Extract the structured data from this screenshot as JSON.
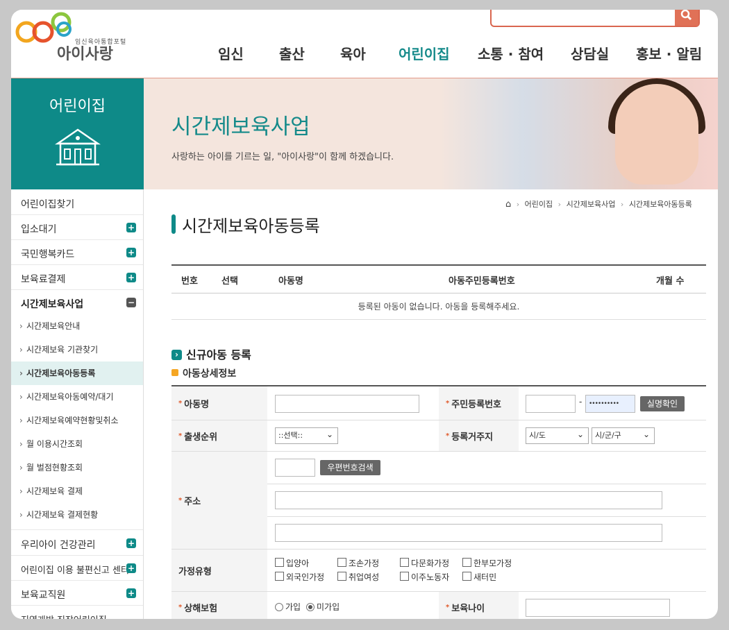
{
  "header": {
    "logo_tagline": "임신육아통합포털",
    "logo_name": "아이사랑",
    "search_placeholder": "",
    "nav": [
      {
        "label": "임신"
      },
      {
        "label": "출산"
      },
      {
        "label": "육아"
      },
      {
        "label": "어린이집"
      },
      {
        "label": "소통 · 참여"
      },
      {
        "label": "상담실"
      },
      {
        "label": "홍보 · 알림"
      }
    ]
  },
  "banner": {
    "section": "어린이집",
    "title": "시간제보육사업",
    "subtitle": "사랑하는 아이를 기르는 일, \"아이사랑\"이 함께 하겠습니다."
  },
  "sidebar": {
    "items": [
      {
        "label": "어린이집찾기"
      },
      {
        "label": "입소대기"
      },
      {
        "label": "국민행복카드"
      },
      {
        "label": "보육료결제"
      },
      {
        "label": "시간제보육사업"
      }
    ],
    "sub_items": [
      {
        "label": "시간제보육안내"
      },
      {
        "label": "시간제보육 기관찾기"
      },
      {
        "label": "시간제보육아동등록"
      },
      {
        "label": "시간제보육아동예약/대기"
      },
      {
        "label": "시간제보육예약현황및취소"
      },
      {
        "label": "월 이용시간조회"
      },
      {
        "label": "월 벌점현황조회"
      },
      {
        "label": "시간제보육 결제"
      },
      {
        "label": "시간제보육 결제현황"
      }
    ],
    "items2": [
      {
        "label": "우리아이 건강관리"
      },
      {
        "label": "어린이집 이용 불편신고 센터"
      },
      {
        "label": "보육교직원"
      },
      {
        "label": "지역개방 직장어린이집"
      }
    ],
    "plus": "+",
    "minus": "−"
  },
  "breadcrumb": {
    "home": "⌂",
    "items": [
      "어린이집",
      "시간제보육사업",
      "시간제보육아동등록"
    ],
    "sep": "›"
  },
  "page_title": "시간제보육아동등록",
  "children_table": {
    "headers": [
      "번호",
      "선택",
      "아동명",
      "아동주민등록번호",
      "개월 수"
    ],
    "empty_message": "등록된 아동이 없습니다. 아동을 등록해주세요."
  },
  "new_child": {
    "title": "신규아동 등록",
    "detail_title": "아동상세정보"
  },
  "form": {
    "name_label": "아동명",
    "name_value": "",
    "rrn_label": "주민등록번호",
    "rrn_first": "",
    "rrn_dash": "-",
    "rrn_second": "••••••••••",
    "verify_btn": "실명확인",
    "birth_order_label": "출생순위",
    "birth_order_value": "::선택::",
    "residence_label": "등록거주지",
    "sido_value": "시/도",
    "sigungu_value": "시/군/구",
    "address_label": "주소",
    "postcode_value": "",
    "postcode_btn": "우편번호검색",
    "address1": "",
    "address2": "",
    "family_label": "가정유형",
    "family_types": [
      "입양아",
      "조손가정",
      "다문화가정",
      "한부모가정",
      "외국인가정",
      "취업여성",
      "이주노동자",
      "새터민"
    ],
    "insurance_label": "상해보험",
    "insurance_options": [
      "가입",
      "미가입"
    ],
    "insurance_selected": "미가입",
    "care_age_label": "보육나이",
    "care_age_value": "",
    "required_mark": "*"
  },
  "colors": {
    "accent": "#0e8a88",
    "search_border": "#d9664f",
    "search_button": "#e07157"
  }
}
